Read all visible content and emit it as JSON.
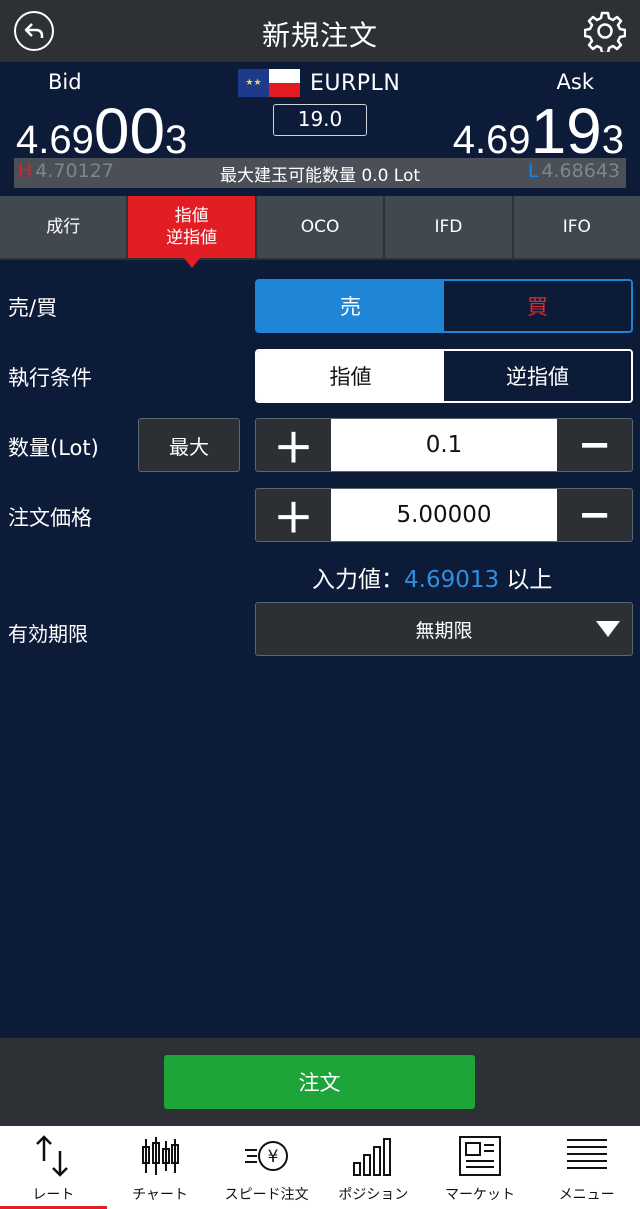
{
  "header": {
    "title": "新規注文"
  },
  "rate": {
    "bid_label": "Bid",
    "ask_label": "Ask",
    "pair": "EURPLN",
    "spread": "19.0",
    "bid": {
      "prefix": "4.69",
      "big": "00",
      "suffix": "3"
    },
    "ask": {
      "prefix": "4.69",
      "big": "19",
      "suffix": "3"
    },
    "high_prefix": "H",
    "high": "4.70127",
    "low_prefix": "L",
    "low": "4.68643",
    "max_lot": "最大建玉可能数量 0.0 Lot"
  },
  "tabs": [
    {
      "line1": "成行",
      "line2": ""
    },
    {
      "line1": "指値",
      "line2": "逆指値"
    },
    {
      "line1": "OCO",
      "line2": ""
    },
    {
      "line1": "IFD",
      "line2": ""
    },
    {
      "line1": "IFO",
      "line2": ""
    }
  ],
  "form": {
    "side_label": "売/買",
    "sell": "売",
    "buy": "買",
    "exec_label": "執行条件",
    "limit": "指値",
    "stop": "逆指値",
    "qty_label": "数量(Lot)",
    "max_button": "最大",
    "qty_value": "0.1",
    "price_label": "注文価格",
    "price_value": "5.00000",
    "hint_prefix": "入力値：",
    "hint_value": "4.69013",
    "hint_suffix": " 以上",
    "expiry_label": "有効期限",
    "expiry_value": "無期限"
  },
  "order_button": "注文",
  "nav": [
    {
      "label": "レート",
      "icon": "rate-arrows-icon"
    },
    {
      "label": "チャート",
      "icon": "candlestick-icon"
    },
    {
      "label": "スピード注文",
      "icon": "speed-order-icon"
    },
    {
      "label": "ポジション",
      "icon": "bar-graph-icon"
    },
    {
      "label": "マーケット",
      "icon": "newspaper-icon"
    },
    {
      "label": "メニュー",
      "icon": "menu-list-icon"
    }
  ],
  "colors": {
    "accent_red": "#e21d24",
    "accent_blue": "#1f86d7",
    "order_green": "#1ea53a",
    "background": "#0c1b38"
  }
}
